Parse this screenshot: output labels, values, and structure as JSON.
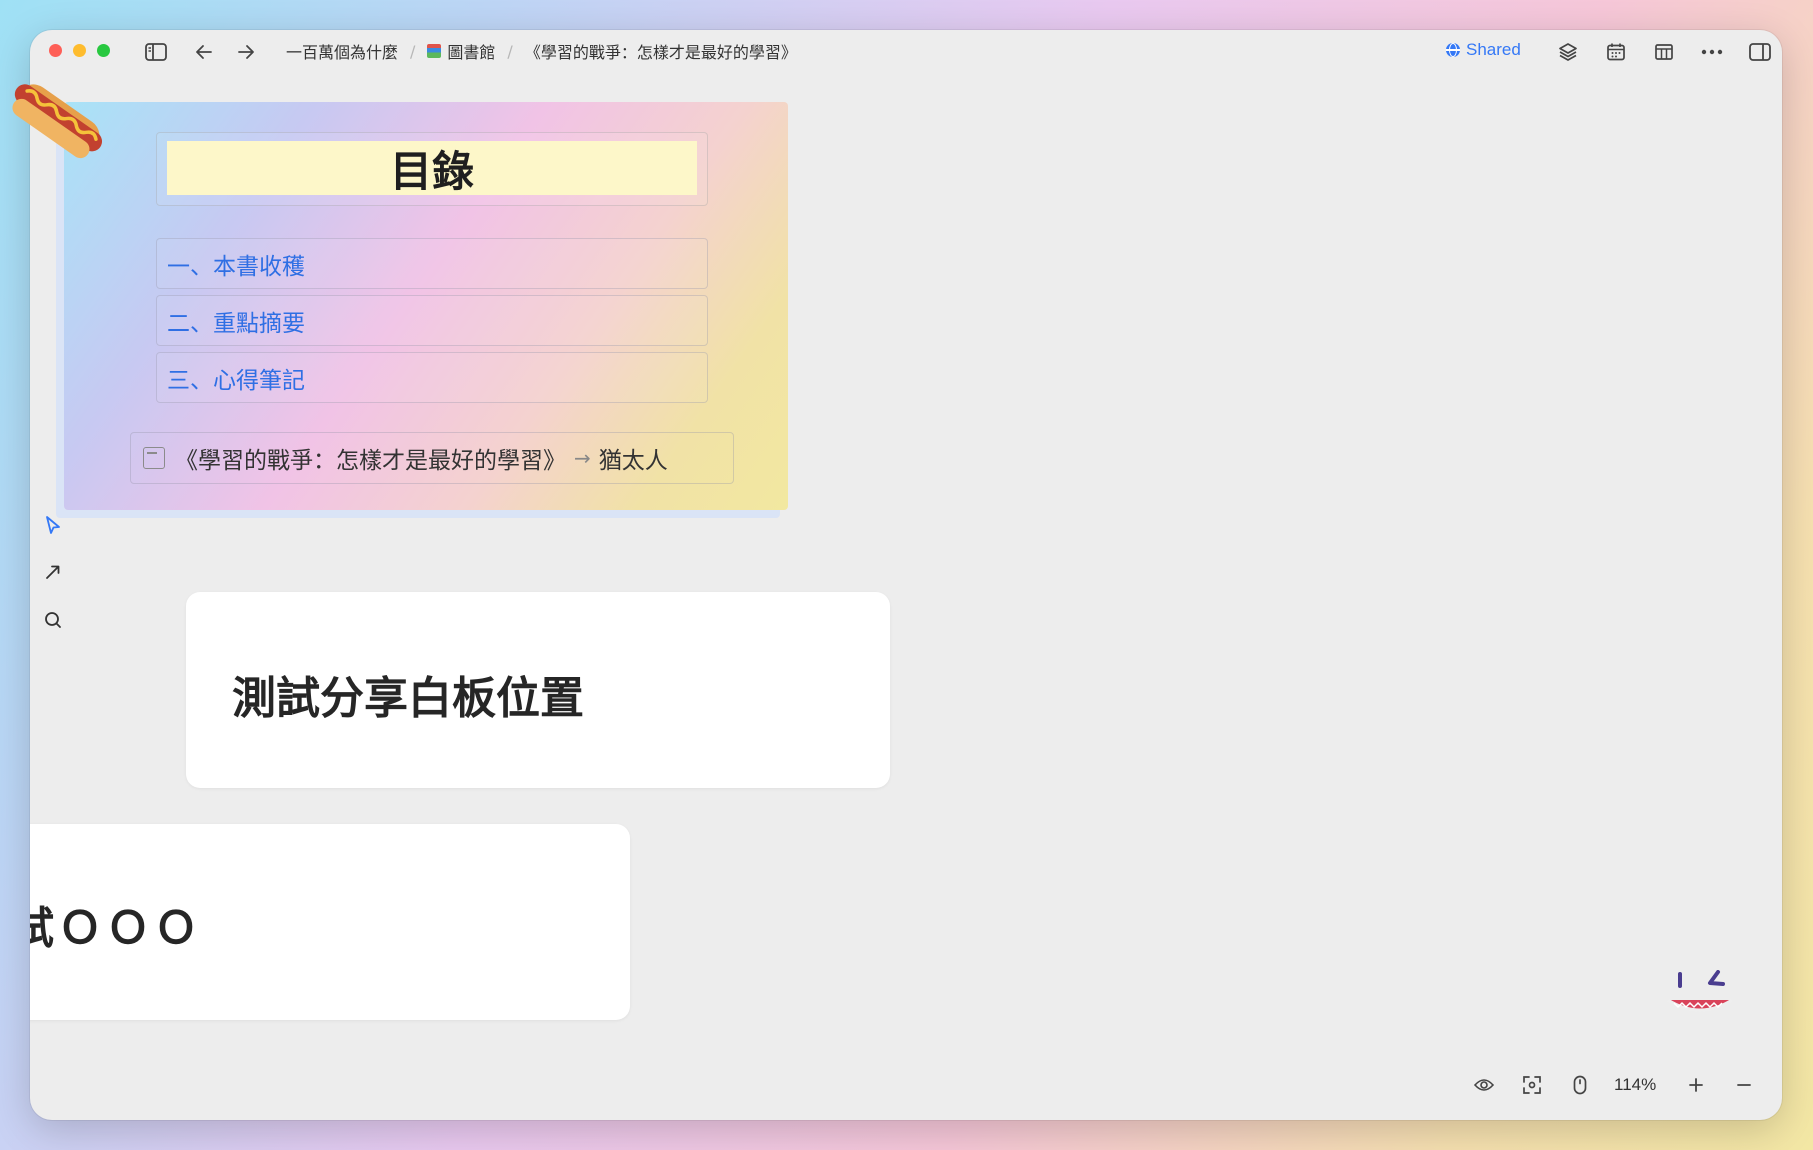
{
  "breadcrumb": {
    "items": [
      "一百萬個為什麼",
      "圖書館",
      "《學習的戰爭：怎樣才是最好的學習》"
    ]
  },
  "toolbar": {
    "shared_label": "Shared"
  },
  "toc": {
    "title": "目錄",
    "items": [
      "一、本書收穫",
      "二、重點摘要",
      "三、心得筆記"
    ],
    "link": {
      "title": "《學習的戰爭：怎樣才是最好的學習》",
      "target": "猶太人"
    }
  },
  "cards": {
    "card1": "測試分享白板位置",
    "card2": "試ＯＯＯ"
  },
  "statusbar": {
    "zoom": "114%"
  },
  "colors": {
    "accent": "#3478f6",
    "link_blue": "#2f6fe4",
    "title_highlight": "#fdf7c9"
  }
}
